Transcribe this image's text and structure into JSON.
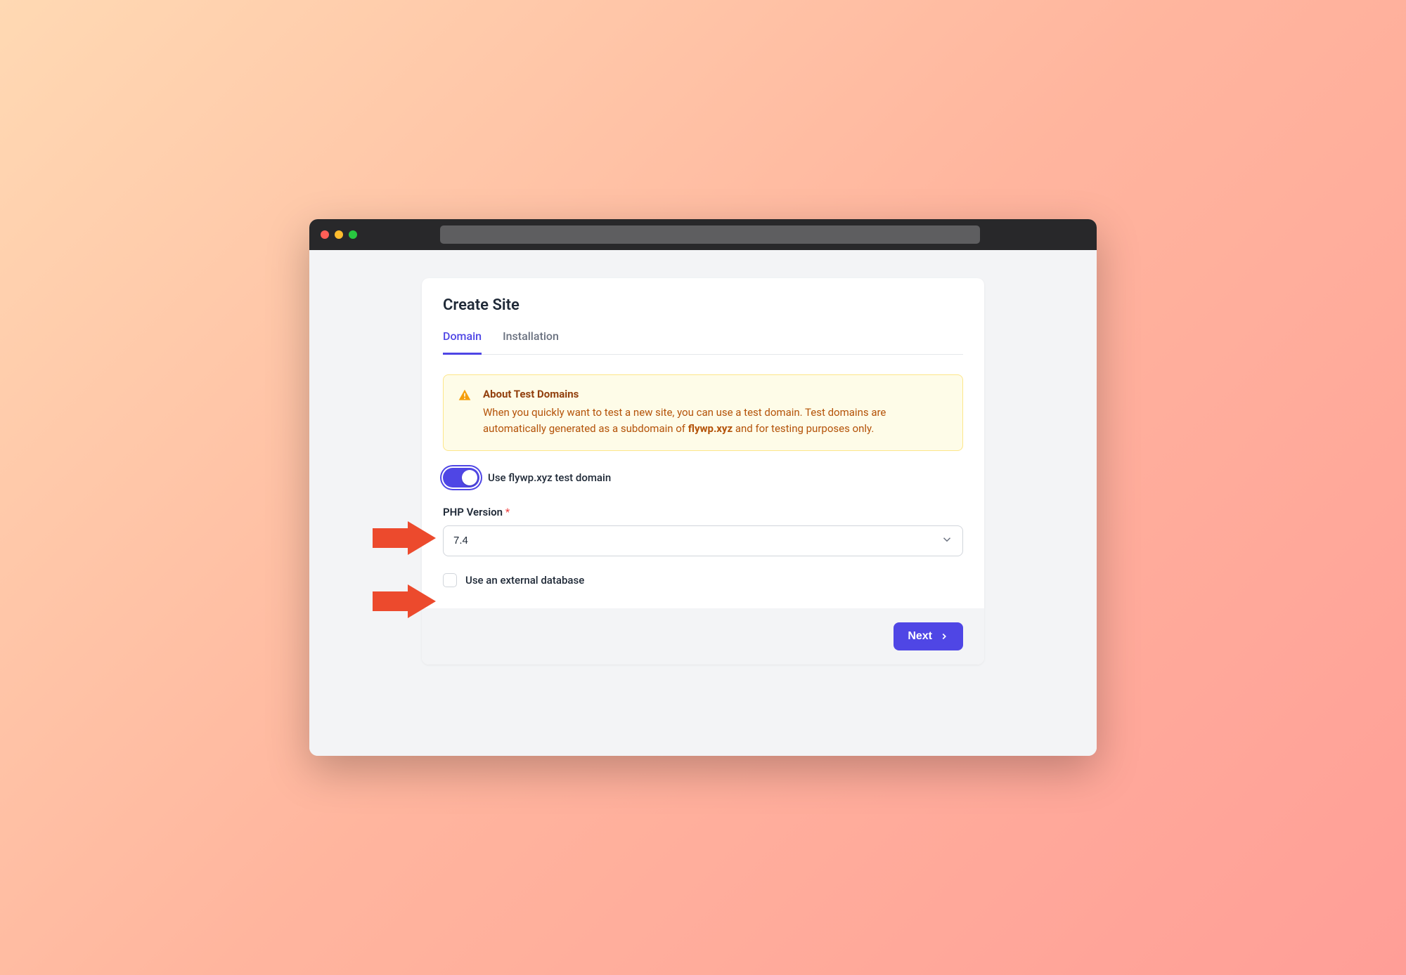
{
  "page": {
    "title": "Create Site"
  },
  "tabs": {
    "domain": "Domain",
    "installation": "Installation"
  },
  "notice": {
    "title": "About Test Domains",
    "body_pre": "When you quickly want to test a new site, you can use a test domain. Test domains are automatically generated as a subdomain of ",
    "body_bold": "flywp.xyz",
    "body_post": " and for testing purposes only."
  },
  "form": {
    "toggle_label": "Use flywp.xyz test domain",
    "toggle_on": true,
    "php_version_label": "PHP Version",
    "php_version_value": "7.4",
    "external_db_label": "Use an external database",
    "external_db_checked": false
  },
  "footer": {
    "next_label": "Next"
  },
  "colors": {
    "accent": "#4f46e5",
    "warning_bg": "#fefce8",
    "warning_border": "#fde68a",
    "warning_text": "#b45309",
    "annotation_arrow": "#ec4a2d"
  }
}
